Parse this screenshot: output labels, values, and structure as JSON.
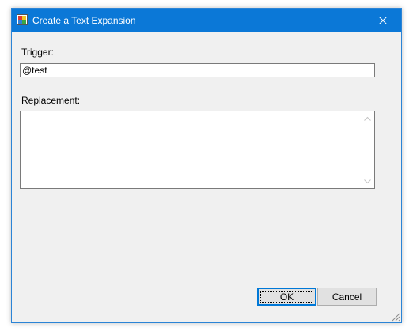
{
  "window": {
    "title": "Create a Text Expansion",
    "titlebar_color": "#0b78d7"
  },
  "icons": {
    "app": "app-icon",
    "minimize": "minimize-icon",
    "maximize": "maximize-icon",
    "close": "close-icon"
  },
  "form": {
    "trigger_label": "Trigger:",
    "trigger_value": "@test",
    "replacement_label": "Replacement:",
    "replacement_value": ""
  },
  "buttons": {
    "ok": "OK",
    "cancel": "Cancel"
  }
}
